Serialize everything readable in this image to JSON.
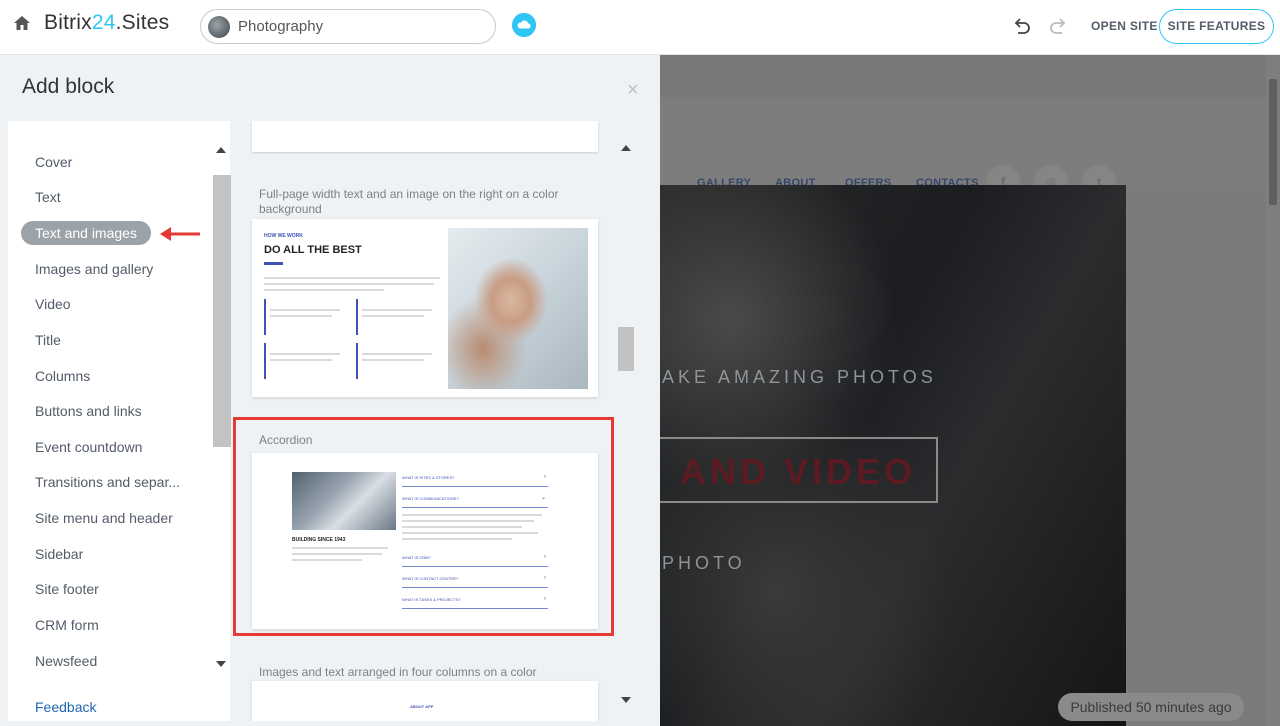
{
  "topbar": {
    "brand_part1": "Bitrix",
    "brand_part2": "24",
    "brand_part3": ".Sites",
    "site_name": "Photography",
    "open_site": "OPEN SITE",
    "site_features": "SITE FEATURES"
  },
  "panel": {
    "title": "Add block",
    "close": "×",
    "categories": [
      {
        "label": "Cover"
      },
      {
        "label": "Text"
      },
      {
        "label": "Text and images",
        "selected": true
      },
      {
        "label": "Images and gallery"
      },
      {
        "label": "Video"
      },
      {
        "label": "Title"
      },
      {
        "label": "Columns"
      },
      {
        "label": "Buttons and links"
      },
      {
        "label": "Event countdown"
      },
      {
        "label": "Transitions and separ..."
      },
      {
        "label": "Site menu and header"
      },
      {
        "label": "Sidebar"
      },
      {
        "label": "Site footer"
      },
      {
        "label": "CRM form"
      },
      {
        "label": "Newsfeed"
      }
    ],
    "feedback": "Feedback",
    "blocks": [
      {
        "label": "Full-page width text and an image on the right on a color background",
        "preview": {
          "kicker": "HOW WE WORK",
          "heading": "DO ALL THE BEST"
        }
      },
      {
        "label": "Accordion",
        "preview": {
          "heading": "BUILDING SINCE 1943",
          "items": [
            "WHAT IS SITES & STORES?",
            "WHAT IS COMMUNICATIONS?",
            "WHAT IS CRM?",
            "WHAT IS CONTACT CENTER?",
            "WHAT IS TASKS & PROJECTS?"
          ]
        }
      },
      {
        "label": "Images and text arranged in four columns on a color background",
        "preview": {
          "kicker": "ABOUT APP"
        }
      }
    ]
  },
  "preview": {
    "nav": [
      "GALLERY",
      "ABOUT",
      "OFFERS",
      "CONTACTS"
    ],
    "social": [
      "f",
      "◎",
      "t"
    ],
    "hero_line1": "AKE AMAZING PHOTOS",
    "hero_line2": "AND VIDEO",
    "hero_line3": "PHOTO",
    "published": "Published 50 minutes ago"
  },
  "colors": {
    "accent": "#2fc6f6",
    "highlight": "#e53935",
    "link": "#2067b0"
  }
}
